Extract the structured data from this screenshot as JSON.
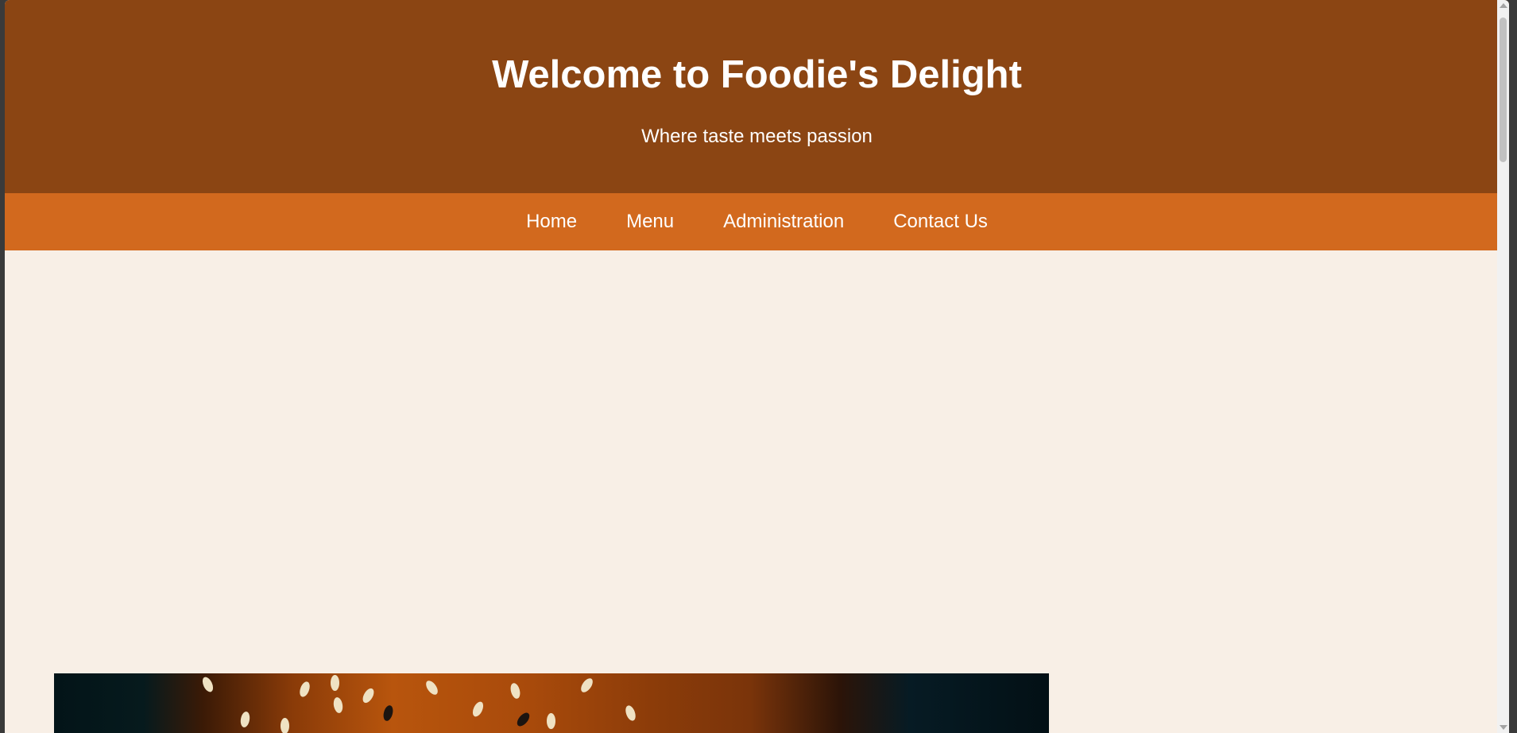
{
  "header": {
    "title": "Welcome to Foodie's Delight",
    "tagline": "Where taste meets passion"
  },
  "nav": {
    "items": [
      {
        "label": "Home"
      },
      {
        "label": "Menu"
      },
      {
        "label": "Administration"
      },
      {
        "label": "Contact Us"
      }
    ]
  },
  "colors": {
    "header_bg": "#8b4513",
    "nav_bg": "#d2691e",
    "page_bg": "#f8efe6",
    "text_light": "#ffffff"
  },
  "hero": {
    "icon": "burger-photo"
  }
}
